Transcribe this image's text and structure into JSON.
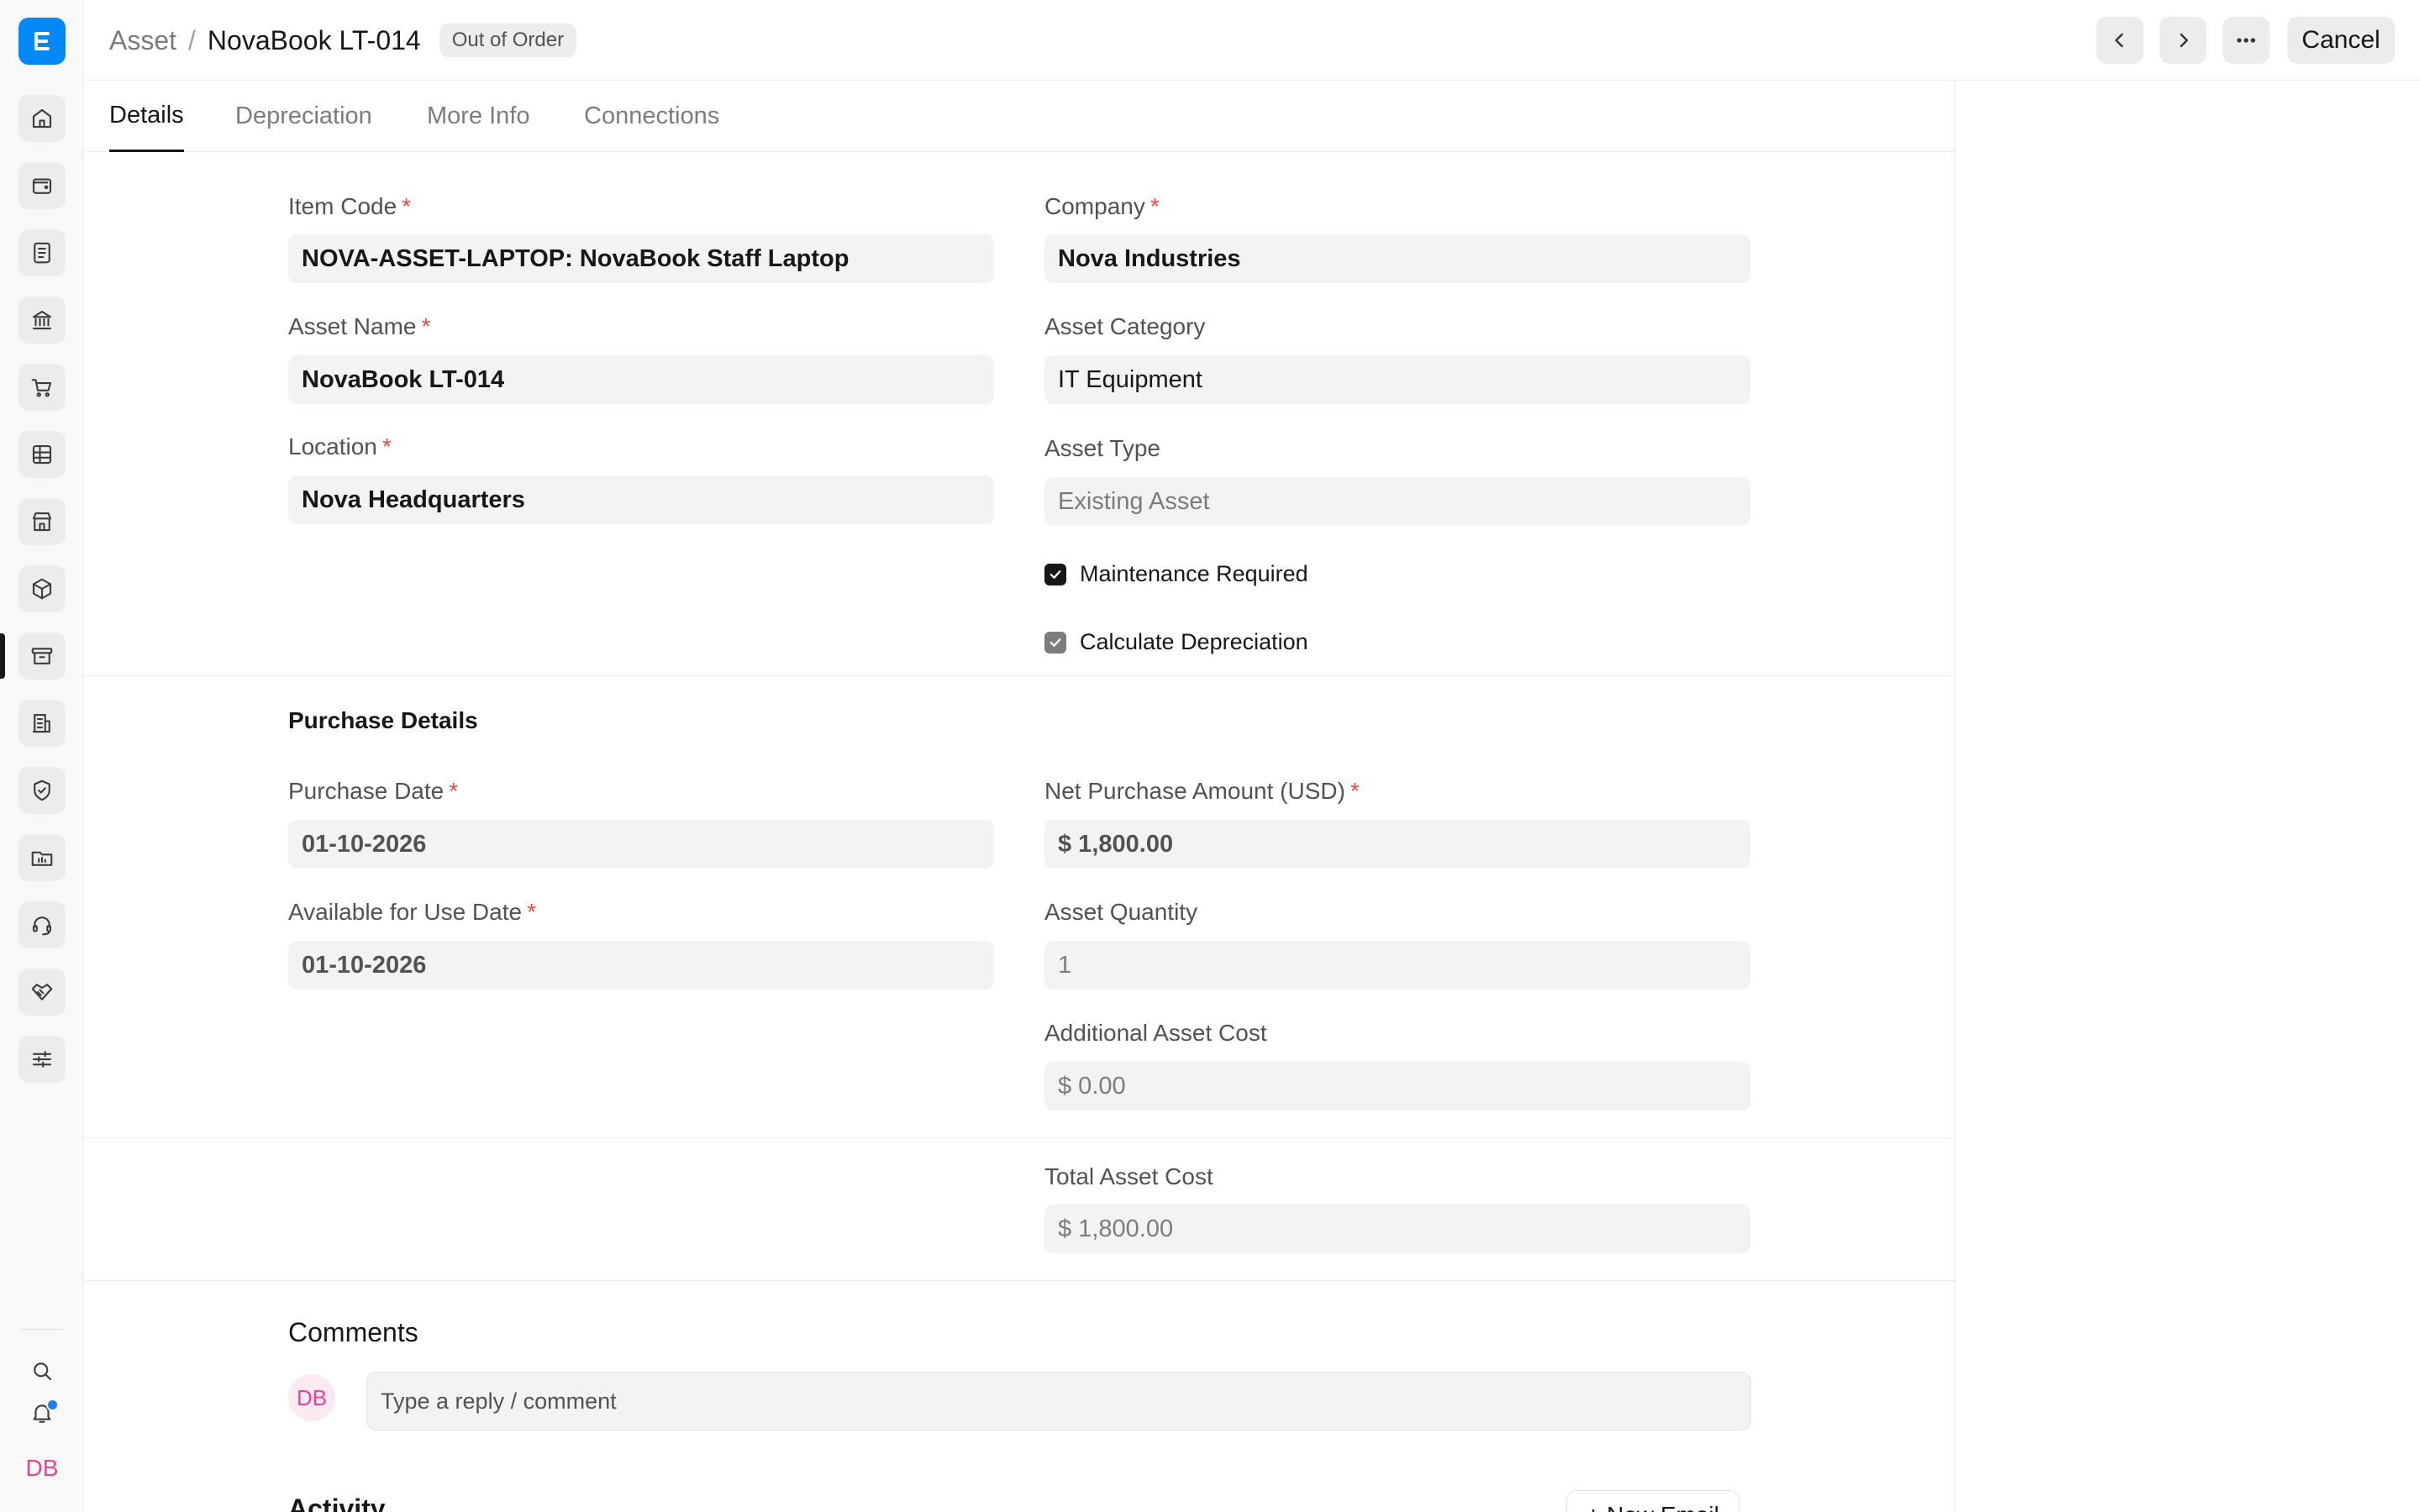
{
  "sidebar": {
    "logo_letter": "E",
    "user_initials": "DB",
    "icons": [
      "home-icon",
      "wallet-icon",
      "file-text-icon",
      "bank-icon",
      "cart-icon",
      "table-icon",
      "store-icon",
      "package-icon",
      "archive-icon",
      "building-icon",
      "shield-icon",
      "folder-icon",
      "headset-icon",
      "handshake-icon",
      "sliders-icon",
      "search-icon",
      "bell-icon"
    ],
    "active_item": "archive-icon",
    "notification_color": "#1b7ef2"
  },
  "header": {
    "breadcrumb_parent": "Asset",
    "breadcrumb_separator": "/",
    "title": "NovaBook LT-014",
    "status_badge": "Out of Order",
    "cancel_label": "Cancel"
  },
  "tabs": [
    {
      "label": "Details",
      "active": true
    },
    {
      "label": "Depreciation",
      "active": false
    },
    {
      "label": "More Info",
      "active": false
    },
    {
      "label": "Connections",
      "active": false
    }
  ],
  "details": {
    "item_code": {
      "label": "Item Code",
      "value": "NOVA-ASSET-LAPTOP: NovaBook Staff Laptop"
    },
    "company": {
      "label": "Company",
      "value": "Nova Industries"
    },
    "asset_name": {
      "label": "Asset Name",
      "value": "NovaBook LT-014"
    },
    "asset_category": {
      "label": "Asset Category",
      "value": "IT Equipment"
    },
    "location": {
      "label": "Location",
      "value": "Nova Headquarters"
    },
    "asset_type": {
      "label": "Asset Type",
      "value": "Existing Asset"
    },
    "maintenance_required": {
      "label": "Maintenance Required",
      "checked": true
    },
    "calculate_depreciation": {
      "label": "Calculate Depreciation",
      "checked": true
    }
  },
  "purchase": {
    "section_title": "Purchase Details",
    "purchase_date": {
      "label": "Purchase Date",
      "value": "01-10-2026"
    },
    "net_purchase_amount": {
      "label": "Net Purchase Amount (USD)",
      "value": "$ 1,800.00"
    },
    "available_for_use_date": {
      "label": "Available for Use Date",
      "value": "01-10-2026"
    },
    "asset_quantity": {
      "label": "Asset Quantity",
      "value": "1"
    },
    "additional_asset_cost": {
      "label": "Additional Asset Cost",
      "value": "$ 0.00"
    }
  },
  "totals": {
    "total_asset_cost": {
      "label": "Total Asset Cost",
      "value": "$ 1,800.00"
    }
  },
  "comments": {
    "title": "Comments",
    "avatar_initials": "DB",
    "placeholder": "Type a reply / comment"
  },
  "activity": {
    "title": "Activity",
    "new_email_label": "+ New Email"
  },
  "colors": {
    "accent_logo": "#0289f7",
    "required_mark": "#e24c4c",
    "avatar_pink": "#e8448f"
  }
}
